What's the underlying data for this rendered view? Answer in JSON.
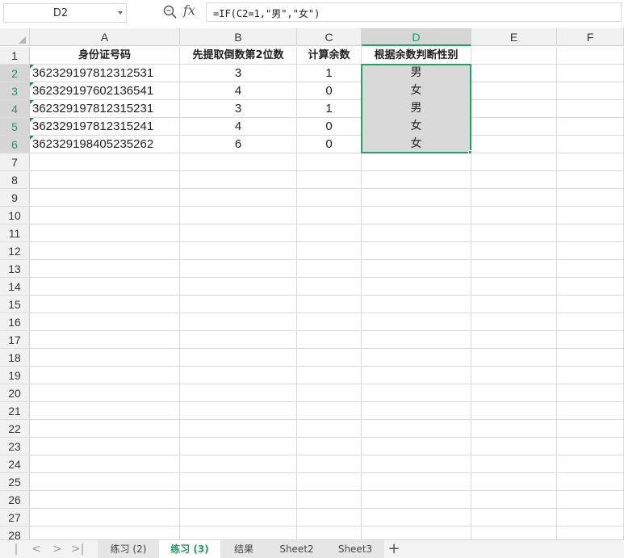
{
  "name_box": "D2",
  "fx_label": "fx",
  "formula": "=IF(C2=1,\"男\",\"女\")",
  "columns": [
    "A",
    "B",
    "C",
    "D",
    "E",
    "F"
  ],
  "selected_column": "D",
  "header_row": [
    "身份证号码",
    "先提取倒数第2位数",
    "计算余数",
    "根据余数判断性别"
  ],
  "data_rows": [
    [
      "362329197812312531",
      "3",
      "1",
      "男"
    ],
    [
      "362329197602136541",
      "4",
      "0",
      "女"
    ],
    [
      "362329197812315231",
      "3",
      "1",
      "男"
    ],
    [
      "362329197812315241",
      "4",
      "0",
      "女"
    ],
    [
      "362329198405235262",
      "6",
      "0",
      "女"
    ]
  ],
  "row_numbers": [
    "1",
    "2",
    "3",
    "4",
    "5",
    "6",
    "7",
    "8",
    "9",
    "10",
    "11",
    "12",
    "13",
    "14",
    "15",
    "16",
    "17",
    "18",
    "19",
    "20",
    "21",
    "22",
    "23",
    "24",
    "25",
    "26",
    "27",
    "28"
  ],
  "selected_rows": [
    "2",
    "3",
    "4",
    "5",
    "6"
  ],
  "sheet_tabs": [
    {
      "label": "练习 (2)",
      "active": false
    },
    {
      "label": "练习 (3)",
      "active": true
    },
    {
      "label": "结果",
      "active": false
    },
    {
      "label": "Sheet2",
      "active": false
    },
    {
      "label": "Sheet3",
      "active": false
    }
  ],
  "nav_icons": [
    "first-sheet-icon",
    "prev-sheet-icon",
    "next-sheet-icon",
    "last-sheet-icon"
  ],
  "add_sheet_label": "+",
  "colors": {
    "accent": "#21a366",
    "selection_fill": "#d9d9d9"
  }
}
